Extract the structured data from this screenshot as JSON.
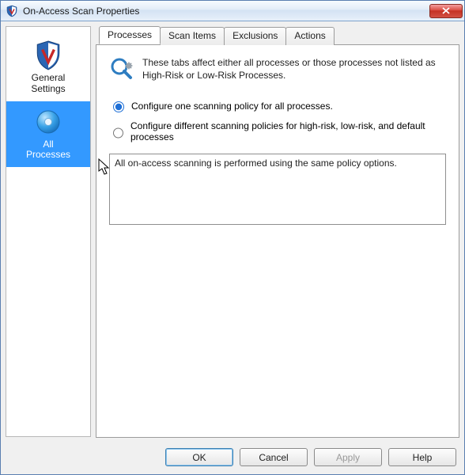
{
  "window": {
    "title": "On-Access Scan Properties"
  },
  "sidebar": {
    "items": [
      {
        "label": "General\nSettings"
      },
      {
        "label": "All\nProcesses"
      }
    ],
    "selected_index": 1
  },
  "tabs": [
    {
      "label": "Processes"
    },
    {
      "label": "Scan Items"
    },
    {
      "label": "Exclusions"
    },
    {
      "label": "Actions"
    }
  ],
  "active_tab": 0,
  "intro_text": "These tabs affect either all processes or those processes not listed as High-Risk or Low-Risk Processes.",
  "radio": {
    "option_one": "Configure one scanning policy for all processes.",
    "option_diff": "Configure different scanning policies for high-risk, low-risk, and default processes",
    "selected": "one"
  },
  "description": "All on-access scanning is performed using the same policy options.",
  "buttons": {
    "ok": "OK",
    "cancel": "Cancel",
    "apply": "Apply",
    "help": "Help",
    "apply_enabled": false
  }
}
